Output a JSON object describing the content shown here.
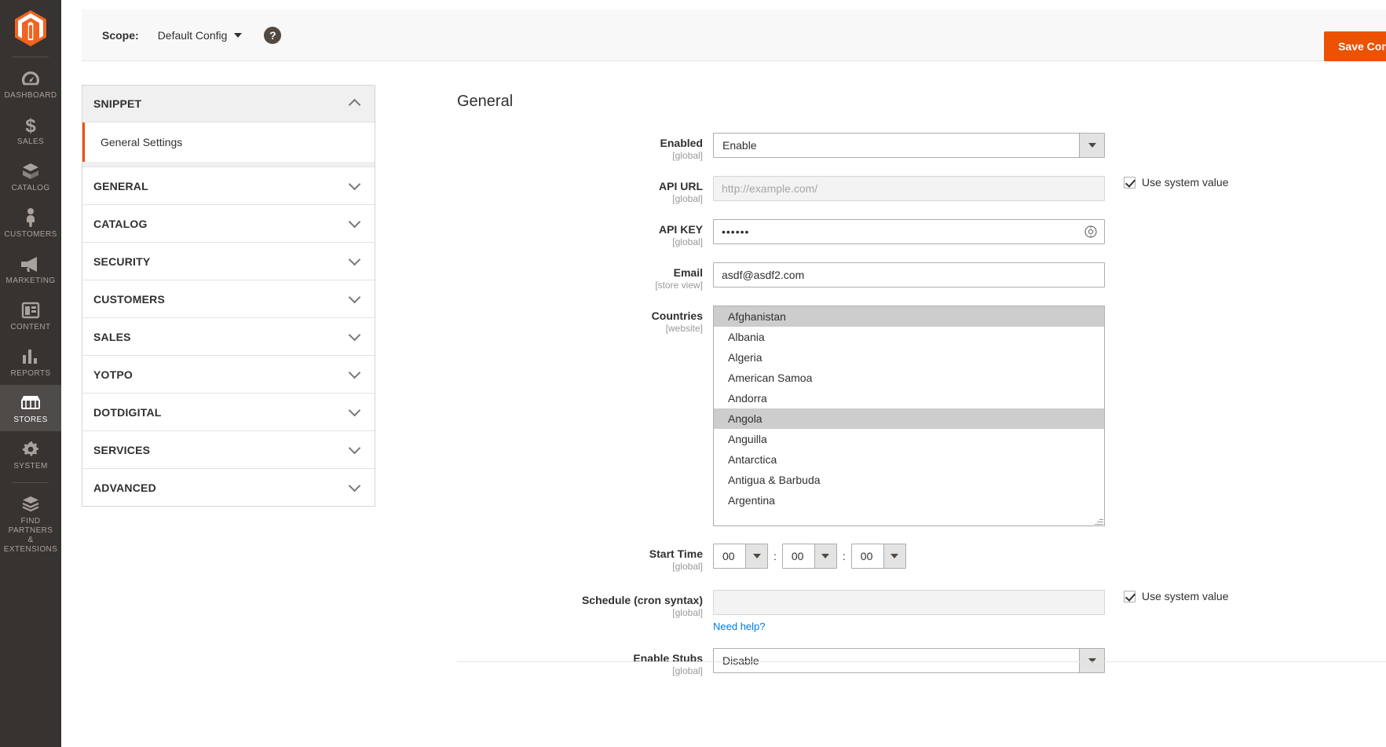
{
  "admin_nav": {
    "logo_name": "magento-logo",
    "items": [
      {
        "label": "DASHBOARD",
        "icon": "dashboard-icon",
        "active": false
      },
      {
        "label": "SALES",
        "icon": "sales-icon",
        "active": false
      },
      {
        "label": "CATALOG",
        "icon": "catalog-icon",
        "active": false
      },
      {
        "label": "CUSTOMERS",
        "icon": "customers-icon",
        "active": false
      },
      {
        "label": "MARKETING",
        "icon": "marketing-icon",
        "active": false
      },
      {
        "label": "CONTENT",
        "icon": "content-icon",
        "active": false
      },
      {
        "label": "REPORTS",
        "icon": "reports-icon",
        "active": false
      },
      {
        "label": "STORES",
        "icon": "stores-icon",
        "active": true
      },
      {
        "label": "SYSTEM",
        "icon": "system-icon",
        "active": false
      },
      {
        "label": "FIND PARTNERS\n& EXTENSIONS",
        "icon": "partners-icon",
        "active": false
      }
    ]
  },
  "scope_bar": {
    "label": "Scope:",
    "value": "Default Config",
    "help_icon": "question-mark-icon",
    "save_label": "Save Config"
  },
  "config_nav": {
    "sections": [
      {
        "title": "SNIPPET",
        "open": true,
        "children": [
          {
            "label": "General Settings",
            "active": true
          }
        ]
      },
      {
        "title": "GENERAL",
        "open": false
      },
      {
        "title": "CATALOG",
        "open": false
      },
      {
        "title": "SECURITY",
        "open": false
      },
      {
        "title": "CUSTOMERS",
        "open": false
      },
      {
        "title": "SALES",
        "open": false
      },
      {
        "title": "YOTPO",
        "open": false
      },
      {
        "title": "DOTDIGITAL",
        "open": false
      },
      {
        "title": "SERVICES",
        "open": false
      },
      {
        "title": "ADVANCED",
        "open": false
      }
    ]
  },
  "form": {
    "section_title": "General",
    "enabled": {
      "label": "Enabled",
      "scope": "[global]",
      "value": "Enable"
    },
    "api_url": {
      "label": "API URL",
      "scope": "[global]",
      "value": "",
      "placeholder": "http://example.com/",
      "use_system_value": "Use system value"
    },
    "api_key": {
      "label": "API KEY",
      "scope": "[global]",
      "value": "••••••",
      "reveal_icon": "eye-icon"
    },
    "email": {
      "label": "Email",
      "scope": "[store view]",
      "value": "asdf@asdf2.com"
    },
    "countries": {
      "label": "Countries",
      "scope": "[website]",
      "options": [
        {
          "label": "Afghanistan",
          "selected": true
        },
        {
          "label": "Albania",
          "selected": false
        },
        {
          "label": "Algeria",
          "selected": false
        },
        {
          "label": "American Samoa",
          "selected": false
        },
        {
          "label": "Andorra",
          "selected": false
        },
        {
          "label": "Angola",
          "selected": true
        },
        {
          "label": "Anguilla",
          "selected": false
        },
        {
          "label": "Antarctica",
          "selected": false
        },
        {
          "label": "Antigua & Barbuda",
          "selected": false
        },
        {
          "label": "Argentina",
          "selected": false
        }
      ]
    },
    "start_time": {
      "label": "Start Time",
      "scope": "[global]",
      "hours": "00",
      "minutes": "00",
      "seconds": "00",
      "separator": ":"
    },
    "schedule": {
      "label": "Schedule (cron syntax)",
      "scope": "[global]",
      "value": "",
      "help_link": "Need help?",
      "use_system_value": "Use system value"
    },
    "enable_stubs": {
      "label": "Enable Stubs",
      "scope": "[global]",
      "value": "Disable"
    }
  },
  "colors": {
    "accent": "#eb5202",
    "nav_bg": "#373330",
    "link": "#007bdb",
    "selected_row": "#cdcdcd"
  }
}
